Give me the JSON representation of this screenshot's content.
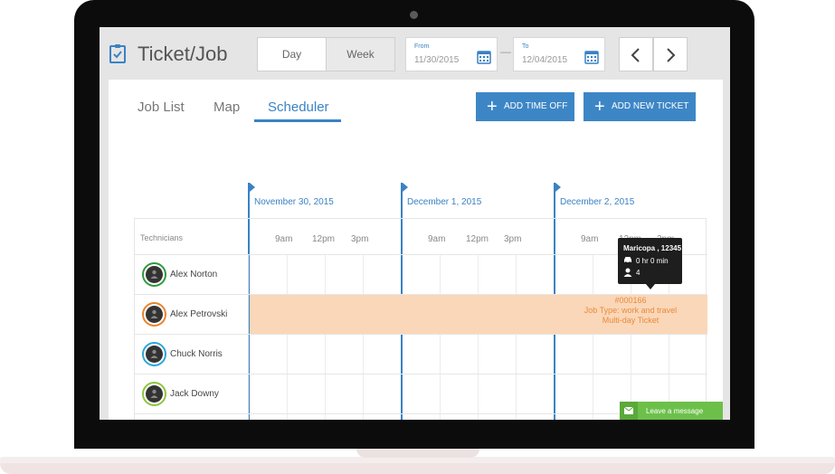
{
  "app": {
    "title": "Ticket/Job"
  },
  "view_toggle": {
    "day": "Day",
    "week": "Week"
  },
  "date_range": {
    "from_label": "From",
    "from_value": "11/30/2015",
    "to_label": "To",
    "to_value": "12/04/2015",
    "separator": "—"
  },
  "tabs": {
    "job_list": "Job List",
    "map": "Map",
    "scheduler": "Scheduler"
  },
  "actions": {
    "add_time_off": "ADD TIME OFF",
    "add_new_ticket": "ADD NEW TICKET"
  },
  "scheduler": {
    "column_header": "Technicians",
    "dates": [
      "November 30, 2015",
      "December 1, 2015",
      "December 2, 2015"
    ],
    "times": [
      "9am",
      "12pm",
      "3pm"
    ],
    "technicians": [
      {
        "name": "Alex Norton",
        "ring_color": "#2e9a3a"
      },
      {
        "name": "Alex Petrovski",
        "ring_color": "#e8842c"
      },
      {
        "name": "Chuck Norris",
        "ring_color": "#2ba8d8"
      },
      {
        "name": "Jack Downy",
        "ring_color": "#8cc63e"
      }
    ],
    "ticket": {
      "number": "#000166",
      "type": "Job Type: work and travel",
      "note": "Multi-day Ticket",
      "color": "#fad7b8"
    },
    "tooltip": {
      "title": "Maricopa , 12345",
      "duration": "0 hr 0 min",
      "count": "4"
    }
  },
  "chat": {
    "label": "Leave a message"
  },
  "colors": {
    "accent": "#3a82c4",
    "button": "#3d86c6",
    "chat": "#6cc04a"
  }
}
